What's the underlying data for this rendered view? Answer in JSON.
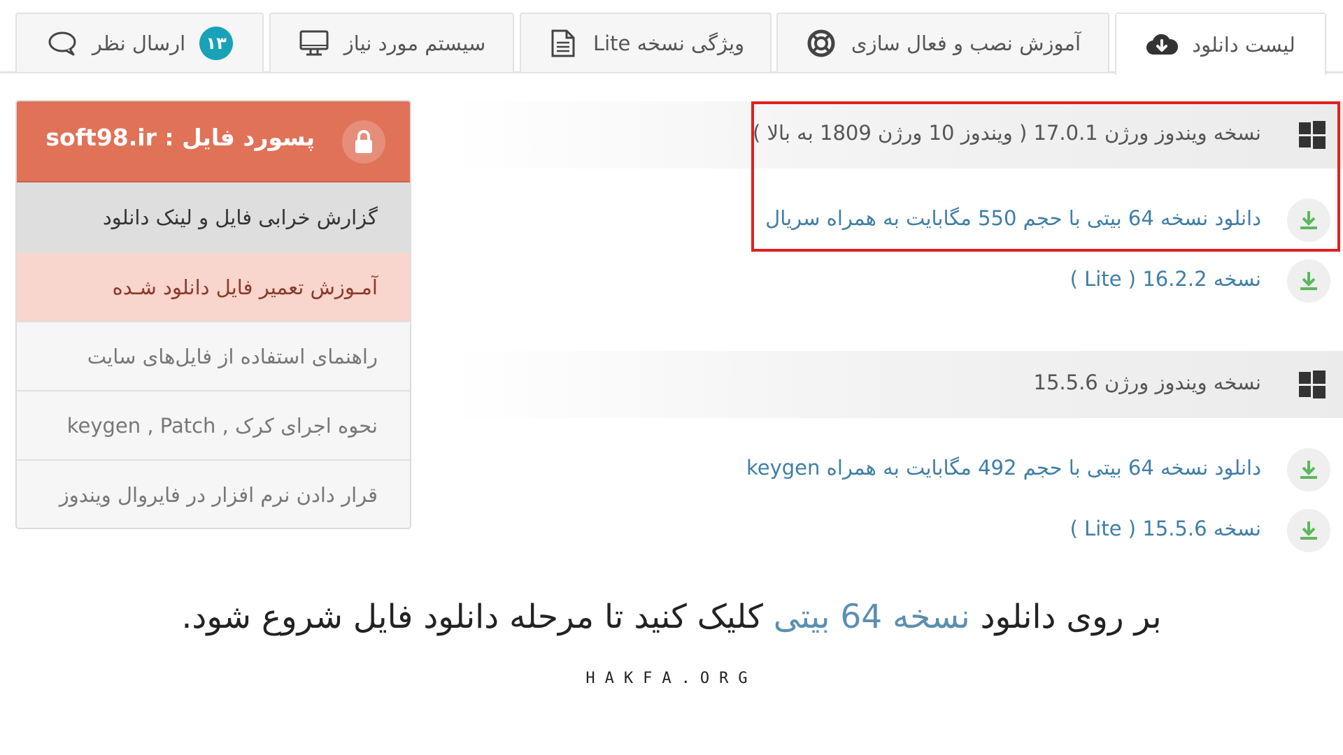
{
  "tabs": [
    {
      "label": "لیست دانلود",
      "icon": "cloud-download-icon",
      "active": true
    },
    {
      "label": "آموزش نصب و فعال سازی",
      "icon": "lifebuoy-icon",
      "active": false
    },
    {
      "label": "ویژگی نسخه Lite",
      "icon": "document-icon",
      "active": false
    },
    {
      "label": "سیستم مورد نیاز",
      "icon": "monitor-icon",
      "active": false
    },
    {
      "label": "ارسال نظر",
      "icon": "comment-icon",
      "badge": "۱۳",
      "active": false
    }
  ],
  "downloads": [
    {
      "version_title": "نسخه ویندوز ورژن 17.0.1 ( ویندوز 10 ورژن 1809 به بالا )",
      "links": [
        "دانلود نسخه 64 بیتی با حجم 550 مگابایت به همراه سریال",
        "نسخه 16.2.2 ( Lite )"
      ]
    },
    {
      "version_title": "نسخه ویندوز ورژن 15.5.6",
      "links": [
        "دانلود نسخه 64 بیتی با حجم 492 مگابایت به همراه keygen",
        "نسخه 15.5.6 ( Lite )"
      ]
    }
  ],
  "sidebar": {
    "password": "پسورد فایل : soft98.ir",
    "items": [
      "گزارش خرابی فایل و لینک دانلود",
      "آمـوزش تعمیر فایل دانلود شـده",
      "راهنمای استفاده از فایل‌های سایت",
      "نحوه اجرای کرک , keygen , Patch",
      "قرار دادن نرم افزار در فایروال ویندوز"
    ]
  },
  "caption": {
    "before": "بر روی دانلود ",
    "highlight": "نسخه 64 بیتی",
    "after": " کلیک کنید تا مرحله دانلود فایل شروع شود."
  },
  "footer": "HAKFA.ORG",
  "colors": {
    "accent_link": "#3f7ea6",
    "password_box": "#e07258",
    "repair_item": "#f8d5cd",
    "report_item": "#dedede",
    "badge": "#17a2b8",
    "download_arrow": "#5cb85c",
    "highlight_border": "#e02020"
  }
}
